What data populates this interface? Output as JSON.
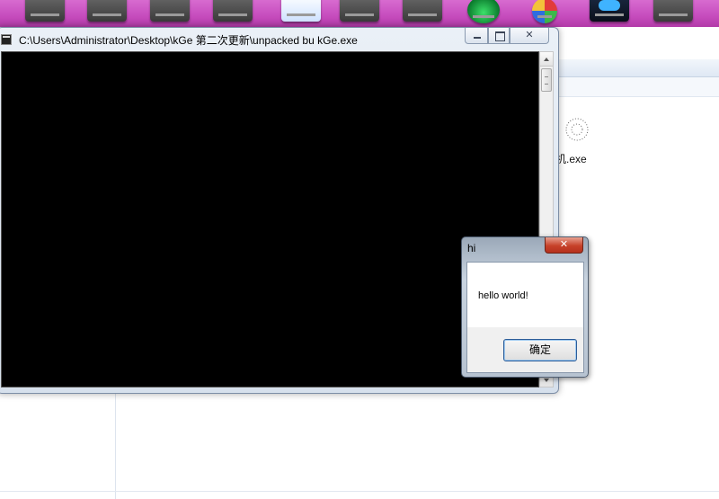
{
  "console_window": {
    "title": "C:\\Users\\Administrator\\Desktop\\kGe 第二次更新\\unpacked bu kGe.exe"
  },
  "explorer": {
    "file_label": "机.exe"
  },
  "message_box": {
    "title": "hi",
    "text": "hello world!",
    "ok_label": "确定"
  },
  "colors": {
    "taskbar": "#c64cbd",
    "console_background": "#000000",
    "close_button": "#c7412a"
  },
  "icons": {
    "console_app": "console-app-icon",
    "minimize": "minimize-icon",
    "maximize": "maximize-icon",
    "close": "close-icon",
    "file": "exe-file-icon"
  }
}
